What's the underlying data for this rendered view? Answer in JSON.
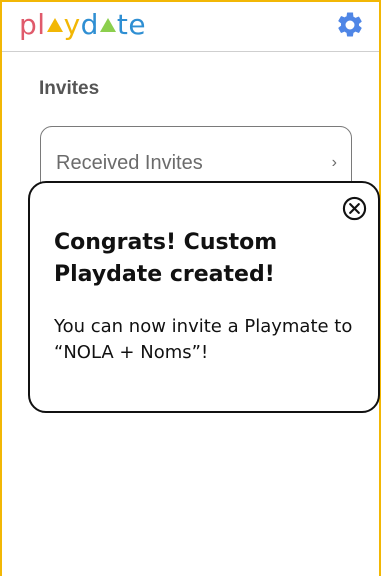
{
  "header": {
    "logo": {
      "parts": [
        {
          "text": "p",
          "color": "#e05a6b"
        },
        {
          "text": "l",
          "color": "#e05a6b"
        },
        {
          "tri": true,
          "color": "#f2b705"
        },
        {
          "text": "y",
          "color": "#f2b705"
        },
        {
          "text": "d",
          "color": "#2f8fd3"
        },
        {
          "tri": true,
          "color": "#8ccf4d"
        },
        {
          "text": "t",
          "color": "#2f8fd3"
        },
        {
          "text": "e",
          "color": "#2f8fd3"
        }
      ]
    },
    "settings_icon": "gear-icon",
    "settings_color": "#4f86e6"
  },
  "invites": {
    "title": "Invites",
    "received_label": "Received Invites",
    "chevron": "›"
  },
  "modal": {
    "title": "Congrats! Custom Playdate created!",
    "body": "You can now invite a Playmate to “NOLA + Noms”!",
    "close_icon": "close-circle-icon"
  },
  "colors": {
    "frame_border": "#f2b705",
    "header_divider": "#cfcfcf"
  }
}
